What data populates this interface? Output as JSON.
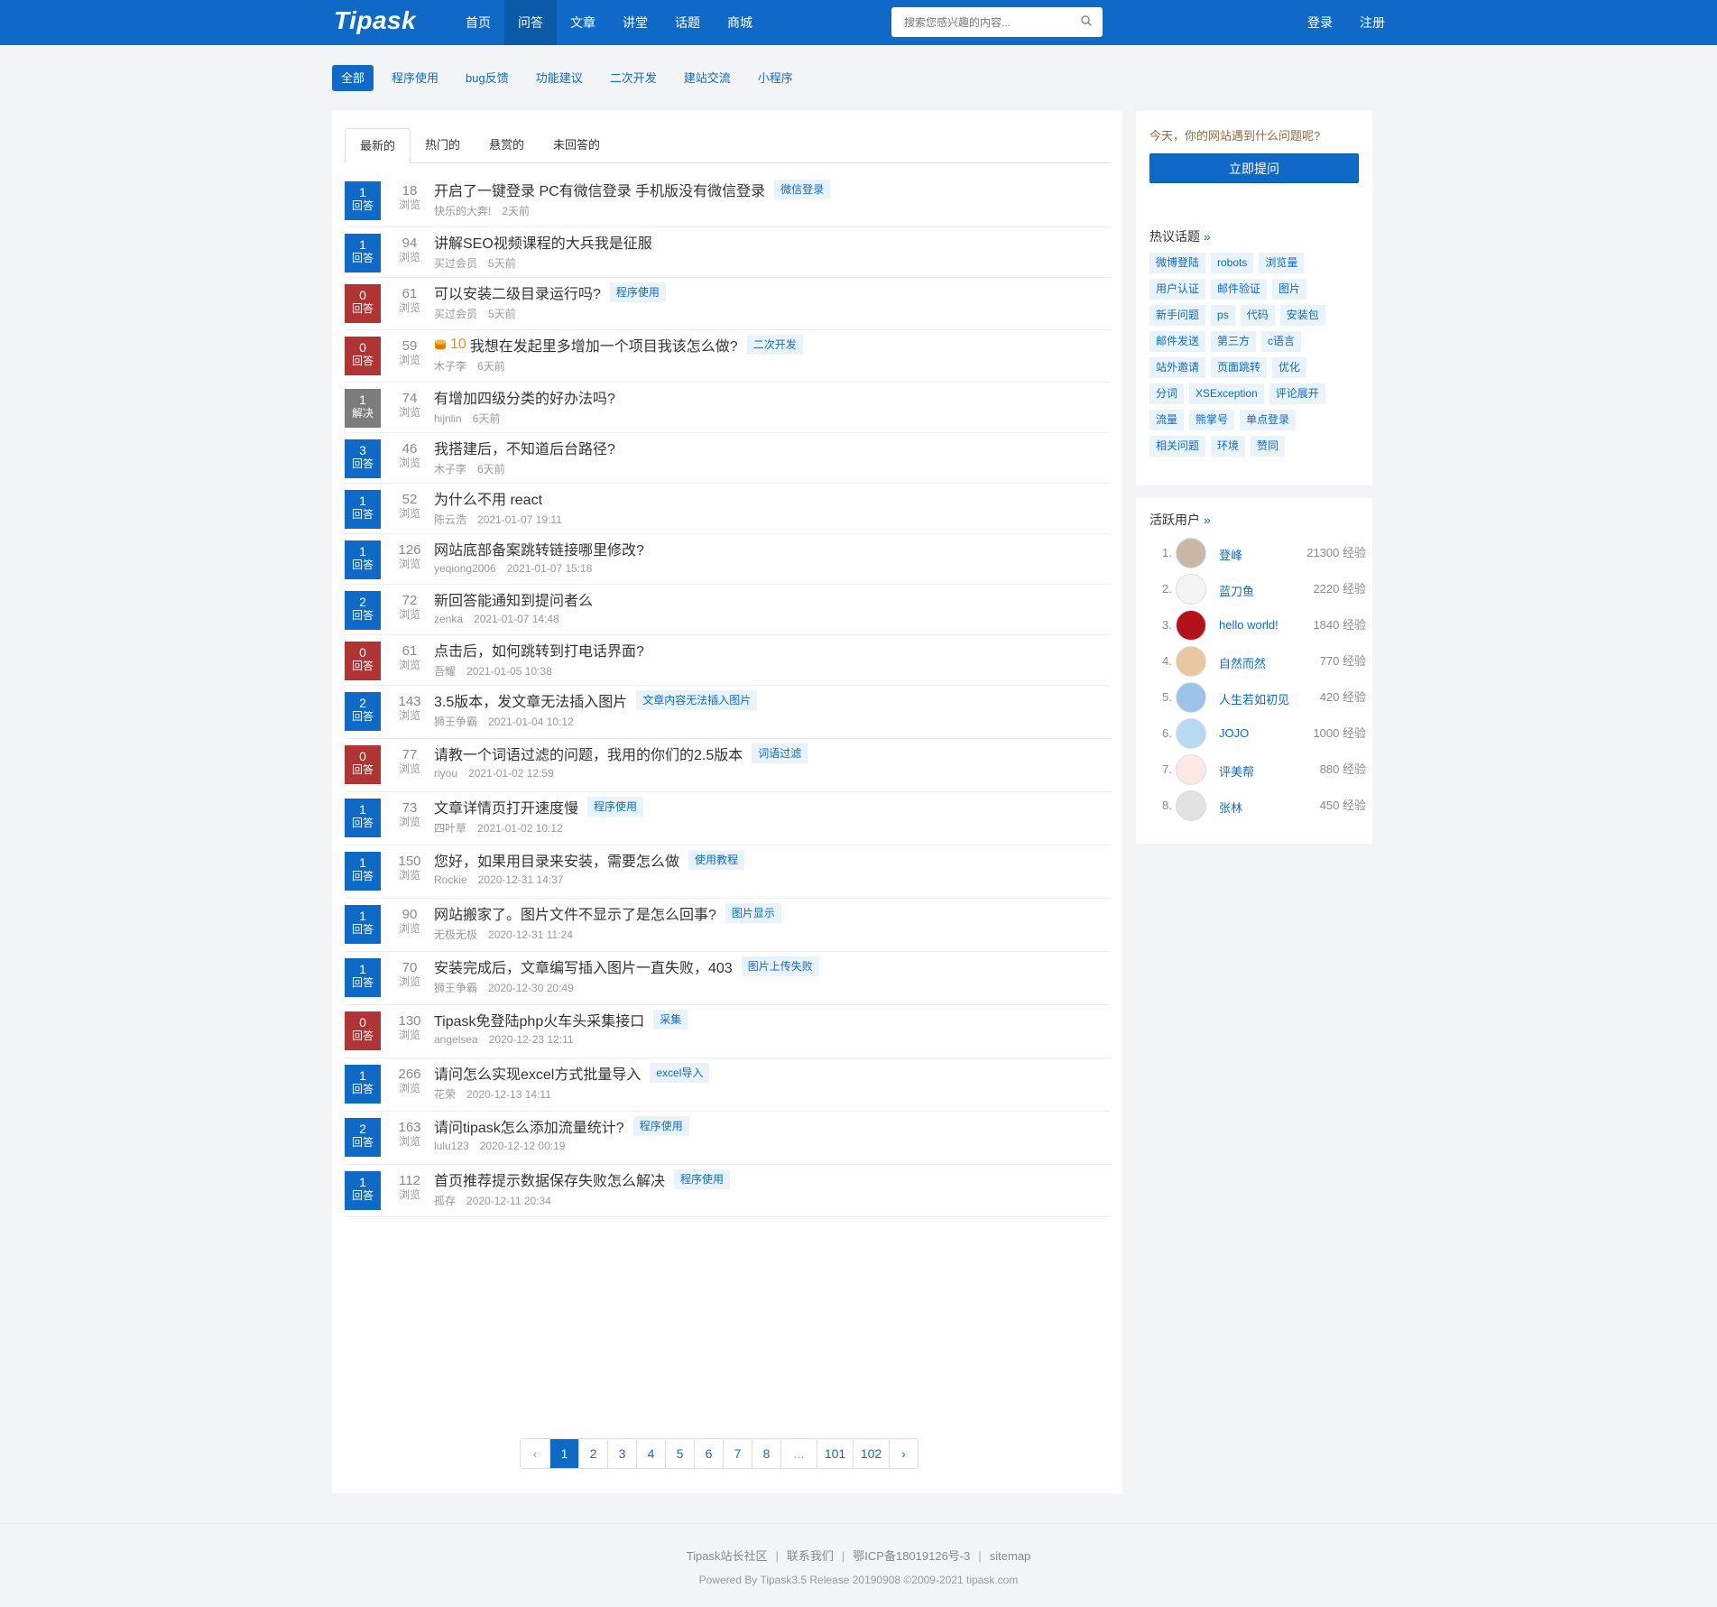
{
  "header": {
    "logo": "Tipask",
    "nav": [
      "首页",
      "问答",
      "文章",
      "讲堂",
      "话题",
      "商城"
    ],
    "nav_active": 1,
    "search_placeholder": "搜索您感兴趣的内容...",
    "login": "登录",
    "register": "注册"
  },
  "categories": [
    "全部",
    "程序使用",
    "bug反馈",
    "功能建议",
    "二次开发",
    "建站交流",
    "小程序"
  ],
  "tabs": [
    "最新的",
    "热门的",
    "悬赏的",
    "未回答的"
  ],
  "questions": [
    {
      "answers": "1",
      "answer_label": "回答",
      "views": "18",
      "views_label": "浏览",
      "title": "开启了一键登录 PC有微信登录 手机版没有微信登录",
      "tag": "微信登录",
      "author": "快乐的大奔!",
      "time": "2天前",
      "color": "blue",
      "bounty": ""
    },
    {
      "answers": "1",
      "answer_label": "回答",
      "views": "94",
      "views_label": "浏览",
      "title": "讲解SEO视频课程的大兵我是征服",
      "tag": "",
      "author": "买过会员",
      "time": "5天前",
      "color": "blue",
      "bounty": ""
    },
    {
      "answers": "0",
      "answer_label": "回答",
      "views": "61",
      "views_label": "浏览",
      "title": "可以安装二级目录运行吗?",
      "tag": "程序使用",
      "author": "买过会员",
      "time": "5天前",
      "color": "red",
      "bounty": ""
    },
    {
      "answers": "0",
      "answer_label": "回答",
      "views": "59",
      "views_label": "浏览",
      "title": "我想在发起里多增加一个项目我该怎么做?",
      "tag": "二次开发",
      "author": "木子李",
      "time": "6天前",
      "color": "red",
      "bounty": "10"
    },
    {
      "answers": "1",
      "answer_label": "解决",
      "views": "74",
      "views_label": "浏览",
      "title": "有增加四级分类的好办法吗?",
      "tag": "",
      "author": "hijnlin",
      "time": "6天前",
      "color": "gray",
      "bounty": ""
    },
    {
      "answers": "3",
      "answer_label": "回答",
      "views": "46",
      "views_label": "浏览",
      "title": "我搭建后，不知道后台路径?",
      "tag": "",
      "author": "木子李",
      "time": "6天前",
      "color": "blue",
      "bounty": ""
    },
    {
      "answers": "1",
      "answer_label": "回答",
      "views": "52",
      "views_label": "浏览",
      "title": "为什么不用 react",
      "tag": "",
      "author": "陈云浩",
      "time": "2021-01-07 19:11",
      "color": "blue",
      "bounty": ""
    },
    {
      "answers": "1",
      "answer_label": "回答",
      "views": "126",
      "views_label": "浏览",
      "title": "网站底部备案跳转链接哪里修改?",
      "tag": "",
      "author": "yeqiong2006",
      "time": "2021-01-07 15:18",
      "color": "blue",
      "bounty": ""
    },
    {
      "answers": "2",
      "answer_label": "回答",
      "views": "72",
      "views_label": "浏览",
      "title": "新回答能通知到提问者么",
      "tag": "",
      "author": "zenka",
      "time": "2021-01-07 14:48",
      "color": "blue",
      "bounty": ""
    },
    {
      "answers": "0",
      "answer_label": "回答",
      "views": "61",
      "views_label": "浏览",
      "title": "点击后，如何跳转到打电话界面?",
      "tag": "",
      "author": "吾耀",
      "time": "2021-01-05 10:38",
      "color": "red",
      "bounty": ""
    },
    {
      "answers": "2",
      "answer_label": "回答",
      "views": "143",
      "views_label": "浏览",
      "title": "3.5版本，发文章无法插入图片",
      "tag": "文章内容无法插入图片",
      "author": "狮王争霸",
      "time": "2021-01-04 10:12",
      "color": "blue",
      "bounty": ""
    },
    {
      "answers": "0",
      "answer_label": "回答",
      "views": "77",
      "views_label": "浏览",
      "title": "请教一个词语过滤的问题，我用的你们的2.5版本",
      "tag": "词语过滤",
      "author": "riyou",
      "time": "2021-01-02 12:59",
      "color": "red",
      "bounty": ""
    },
    {
      "answers": "1",
      "answer_label": "回答",
      "views": "73",
      "views_label": "浏览",
      "title": "文章详情页打开速度慢",
      "tag": "程序使用",
      "author": "四叶草",
      "time": "2021-01-02 10:12",
      "color": "blue",
      "bounty": ""
    },
    {
      "answers": "1",
      "answer_label": "回答",
      "views": "150",
      "views_label": "浏览",
      "title": "您好，如果用目录来安装，需要怎么做",
      "tag": "使用教程",
      "author": "Rockie",
      "time": "2020-12-31 14:37",
      "color": "blue",
      "bounty": ""
    },
    {
      "answers": "1",
      "answer_label": "回答",
      "views": "90",
      "views_label": "浏览",
      "title": "网站搬家了。图片文件不显示了是怎么回事?",
      "tag": "图片显示",
      "author": "无极无极",
      "time": "2020-12-31 11:24",
      "color": "blue",
      "bounty": ""
    },
    {
      "answers": "1",
      "answer_label": "回答",
      "views": "70",
      "views_label": "浏览",
      "title": "安装完成后，文章编写插入图片一直失败，403",
      "tag": "图片上传失败",
      "author": "狮王争霸",
      "time": "2020-12-30 20:49",
      "color": "blue",
      "bounty": ""
    },
    {
      "answers": "0",
      "answer_label": "回答",
      "views": "130",
      "views_label": "浏览",
      "title": "Tipask免登陆php火车头采集接口",
      "tag": "采集",
      "author": "angelsea",
      "time": "2020-12-23 12:11",
      "color": "red",
      "bounty": ""
    },
    {
      "answers": "1",
      "answer_label": "回答",
      "views": "266",
      "views_label": "浏览",
      "title": "请问怎么实现excel方式批量导入",
      "tag": "excel导入",
      "author": "花荣",
      "time": "2020-12-13 14:11",
      "color": "blue",
      "bounty": ""
    },
    {
      "answers": "2",
      "answer_label": "回答",
      "views": "163",
      "views_label": "浏览",
      "title": "请问tipask怎么添加流量统计?",
      "tag": "程序使用",
      "author": "lulu123",
      "time": "2020-12-12 00:19",
      "color": "blue",
      "bounty": ""
    },
    {
      "answers": "1",
      "answer_label": "回答",
      "views": "112",
      "views_label": "浏览",
      "title": "首页推荐提示数据保存失败怎么解决",
      "tag": "程序使用",
      "author": "孤存",
      "time": "2020-12-11 20:34",
      "color": "blue",
      "bounty": ""
    }
  ],
  "pagination": [
    "‹",
    "1",
    "2",
    "3",
    "4",
    "5",
    "6",
    "7",
    "8",
    "...",
    "101",
    "102",
    "›"
  ],
  "sidebar": {
    "ask_hint": "今天，你的网站遇到什么问题呢?",
    "ask_button": "立即提问",
    "hot_title": "热议话题",
    "more": "»",
    "hot_tags": [
      [
        "微博登陆",
        "robots",
        "浏览量"
      ],
      [
        "用户认证",
        "邮件验证",
        "图片"
      ],
      [
        "新手问题",
        "ps",
        "代码",
        "安装包"
      ],
      [
        "邮件发送",
        "第三方",
        "c语言"
      ],
      [
        "站外邀请",
        "页面跳转",
        "优化"
      ],
      [
        "分词",
        "XSException",
        "评论展开"
      ],
      [
        "流量",
        "熊掌号",
        "单点登录"
      ],
      [
        "相关问题",
        "环境",
        "赞同"
      ]
    ],
    "users_title": "活跃用户",
    "users": [
      {
        "rank": "1.",
        "name": "登峰",
        "exp": "21300 经验",
        "avatar": "#c9b8a6"
      },
      {
        "rank": "2.",
        "name": "蓝刀鱼",
        "exp": "2220 经验",
        "avatar": "#f4f4f4"
      },
      {
        "rank": "3.",
        "name": "hello world!",
        "exp": "1840 经验",
        "avatar": "#b3121a"
      },
      {
        "rank": "4.",
        "name": "自然而然",
        "exp": "770 经验",
        "avatar": "#e9c7a0"
      },
      {
        "rank": "5.",
        "name": "人生若如初见",
        "exp": "420 经验",
        "avatar": "#9cc4e8"
      },
      {
        "rank": "6.",
        "name": "JOJO",
        "exp": "1000 经验",
        "avatar": "#b8d9f2"
      },
      {
        "rank": "7.",
        "name": "评美帮",
        "exp": "880 经验",
        "avatar": "#fde9e4"
      },
      {
        "rank": "8.",
        "name": "张林",
        "exp": "450 经验",
        "avatar": "#e2e2e2"
      }
    ]
  },
  "footer": {
    "links": [
      "Tipask站长社区",
      "联系我们",
      "鄂ICP备18019126号-3",
      "sitemap"
    ],
    "copyright": "Powered By Tipask3.5 Release 20190908 ©2009-2021 tipask.com"
  }
}
